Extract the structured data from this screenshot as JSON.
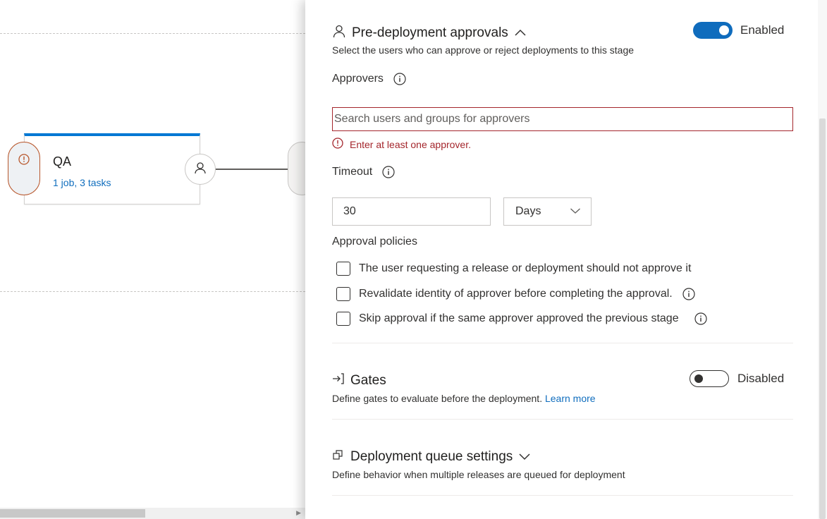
{
  "canvas": {
    "stage": {
      "name": "QA",
      "summary": "1 job, 3 tasks"
    }
  },
  "panel": {
    "approvals": {
      "title": "Pre-deployment approvals",
      "description": "Select the users who can approve or reject deployments to this stage",
      "toggle_label": "Enabled",
      "approvers_label": "Approvers",
      "search_placeholder": "Search users and groups for approvers",
      "error_text": "Enter at least one approver.",
      "timeout_label": "Timeout",
      "timeout_value": "30",
      "timeout_unit": "Days",
      "policies_label": "Approval policies",
      "policies": [
        {
          "label": "The user requesting a release or deployment should not approve it",
          "checked": false
        },
        {
          "label": "Revalidate identity of approver before completing the approval.",
          "checked": false
        },
        {
          "label": "Skip approval if the same approver approved the previous stage",
          "checked": false
        }
      ]
    },
    "gates": {
      "title": "Gates",
      "description": "Define gates to evaluate before the deployment.",
      "learn_more": "Learn more",
      "toggle_label": "Disabled"
    },
    "queue": {
      "title": "Deployment queue settings",
      "description": "Define behavior when multiple releases are queued for deployment"
    }
  },
  "colors": {
    "accent": "#0f6cbd",
    "error": "#a4262c",
    "link": "#106ebe"
  }
}
